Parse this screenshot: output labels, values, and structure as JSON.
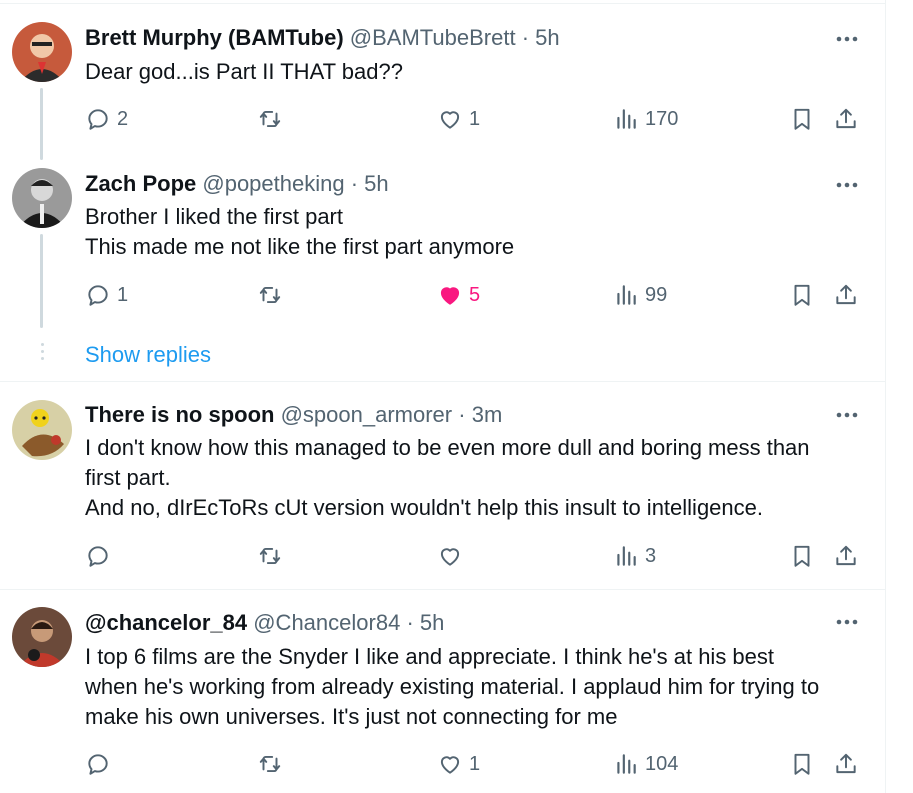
{
  "colors": {
    "text": "#0f1419",
    "muted": "#536471",
    "link": "#1d9bf0",
    "like_active": "#f91880",
    "border": "#eff3f4",
    "thread_line": "#cfd9de"
  },
  "replies": [
    {
      "name": "Brett Murphy (BAMTube)",
      "handle": "@BAMTubeBrett",
      "dot": "·",
      "time": "5h",
      "lines": [
        "Dear god...is Part II THAT bad??"
      ],
      "reply_count": "2",
      "retweet_count": "",
      "like_count": "1",
      "liked": false,
      "views": "170"
    },
    {
      "name": "Zach Pope",
      "handle": "@popetheking",
      "dot": "·",
      "time": "5h",
      "lines": [
        "Brother I liked the first part",
        "This made me not like the first part anymore"
      ],
      "reply_count": "1",
      "retweet_count": "",
      "like_count": "5",
      "liked": true,
      "views": "99"
    },
    {
      "name": "There is no spoon",
      "handle": "@spoon_armorer",
      "dot": "·",
      "time": "3m",
      "lines": [
        "I don't know how this managed to be even more dull and boring mess than",
        "first part.",
        "And no, dIrEcToRs cUt version wouldn't help this insult to intelligence."
      ],
      "reply_count": "",
      "retweet_count": "",
      "like_count": "",
      "liked": false,
      "views": "3"
    },
    {
      "name": "@chancelor_84",
      "handle": "@Chancelor84",
      "dot": "·",
      "time": "5h",
      "lines": [
        "I top 6 films are the Snyder I like and appreciate. I think he's at his best",
        "when he's working from already existing material. I applaud him for trying to",
        "make his own universes. It's just not connecting for me"
      ],
      "reply_count": "",
      "retweet_count": "",
      "like_count": "1",
      "liked": false,
      "views": "104"
    }
  ],
  "show_replies_label": "Show replies",
  "icons": [
    "more-icon",
    "reply-icon",
    "retweet-icon",
    "like-icon",
    "views-icon",
    "bookmark-icon",
    "share-icon"
  ]
}
